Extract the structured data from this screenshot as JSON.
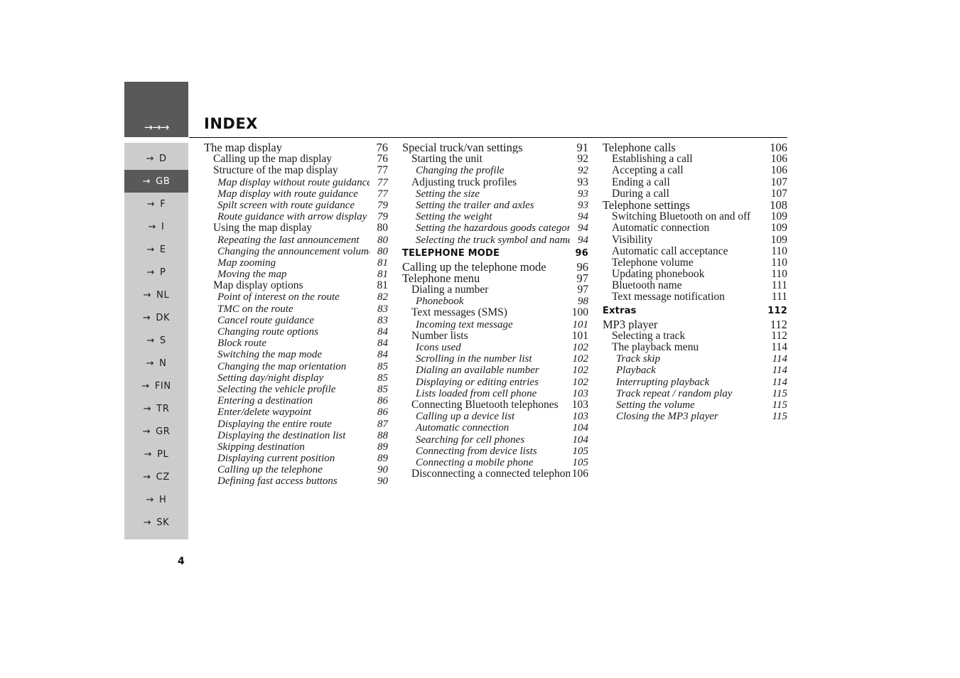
{
  "page_title": "INDEX",
  "folio": "4",
  "colors": {
    "rail_dark": "#595959",
    "rail_light": "#cccccc",
    "text": "#1a1a1a"
  },
  "nav": {
    "header_arrows": "→→→",
    "arrow_glyph": "→",
    "items": [
      {
        "label": "D",
        "active": false
      },
      {
        "label": "GB",
        "active": true
      },
      {
        "label": "F",
        "active": false
      },
      {
        "label": "I",
        "active": false
      },
      {
        "label": "E",
        "active": false
      },
      {
        "label": "P",
        "active": false
      },
      {
        "label": "NL",
        "active": false
      },
      {
        "label": "DK",
        "active": false
      },
      {
        "label": "S",
        "active": false
      },
      {
        "label": "N",
        "active": false
      },
      {
        "label": "FIN",
        "active": false
      },
      {
        "label": "TR",
        "active": false
      },
      {
        "label": "GR",
        "active": false
      },
      {
        "label": "PL",
        "active": false
      },
      {
        "label": "CZ",
        "active": false
      },
      {
        "label": "H",
        "active": false
      },
      {
        "label": "SK",
        "active": false
      }
    ]
  },
  "columns": [
    {
      "id": "column-1",
      "entries": [
        {
          "level": 1,
          "label": "The map display",
          "page": "76"
        },
        {
          "level": 2,
          "label": "Calling up the map display",
          "page": "76"
        },
        {
          "level": 2,
          "label": "Structure of the map display",
          "page": "77"
        },
        {
          "level": 3,
          "label": "Map display without route guidance",
          "page": "77"
        },
        {
          "level": 3,
          "label": "Map display with route guidance",
          "page": "77"
        },
        {
          "level": 3,
          "label": "Spilt screen with route guidance",
          "page": "79"
        },
        {
          "level": 3,
          "label": "Route guidance with arrow display",
          "page": "79"
        },
        {
          "level": 2,
          "label": "Using the map display",
          "page": "80"
        },
        {
          "level": 3,
          "label": "Repeating the last announcement",
          "page": "80"
        },
        {
          "level": 3,
          "label": "Changing the announcement volume",
          "page": "80"
        },
        {
          "level": 3,
          "label": "Map zooming",
          "page": "81"
        },
        {
          "level": 3,
          "label": "Moving the map",
          "page": "81"
        },
        {
          "level": 2,
          "label": "Map display options",
          "page": "81"
        },
        {
          "level": 3,
          "label": "Point of interest on the route",
          "page": "82"
        },
        {
          "level": 3,
          "label": "TMC on the route",
          "page": "83"
        },
        {
          "level": 3,
          "label": "Cancel route guidance",
          "page": "83"
        },
        {
          "level": 3,
          "label": "Changing route options",
          "page": "84"
        },
        {
          "level": 3,
          "label": "Block route",
          "page": "84"
        },
        {
          "level": 3,
          "label": "Switching the map mode",
          "page": "84"
        },
        {
          "level": 3,
          "label": "Changing the map orientation",
          "page": "85"
        },
        {
          "level": 3,
          "label": "Setting day/night display",
          "page": "85"
        },
        {
          "level": 3,
          "label": "Selecting the vehicle profile",
          "page": "85"
        },
        {
          "level": 3,
          "label": "Entering a destination",
          "page": "86"
        },
        {
          "level": 3,
          "label": "Enter/delete waypoint",
          "page": "86"
        },
        {
          "level": 3,
          "label": "Displaying the entire route",
          "page": "87"
        },
        {
          "level": 3,
          "label": "Displaying the destination list",
          "page": "88"
        },
        {
          "level": 3,
          "label": "Skipping destination",
          "page": "89"
        },
        {
          "level": 3,
          "label": "Displaying current position",
          "page": "89"
        },
        {
          "level": 3,
          "label": "Calling up the telephone",
          "page": "90"
        },
        {
          "level": 3,
          "label": "Defining fast access buttons",
          "page": "90"
        }
      ]
    },
    {
      "id": "column-2",
      "entries": [
        {
          "level": 1,
          "label": "Special truck/van settings",
          "page": "91"
        },
        {
          "level": 2,
          "label": "Starting the unit",
          "page": "92"
        },
        {
          "level": 3,
          "label": "Changing the profile",
          "page": "92"
        },
        {
          "level": 2,
          "label": "Adjusting truck profiles",
          "page": "93"
        },
        {
          "level": 3,
          "label": "Setting the size",
          "page": "93"
        },
        {
          "level": 3,
          "label": "Setting the trailer and axles",
          "page": "93"
        },
        {
          "level": 3,
          "label": "Setting the weight",
          "page": "94"
        },
        {
          "level": 3,
          "label": "Setting the hazardous goods category",
          "page": "94"
        },
        {
          "level": 3,
          "label": "Selecting the truck symbol and name",
          "page": "94"
        },
        {
          "level": 0,
          "label": "TELEPHONE MODE",
          "page": "96"
        },
        {
          "level": 1,
          "label": "Calling up the telephone mode",
          "page": "96"
        },
        {
          "level": 1,
          "label": "Telephone menu",
          "page": "97"
        },
        {
          "level": 2,
          "label": "Dialing a number",
          "page": "97"
        },
        {
          "level": 3,
          "label": "Phonebook",
          "page": "98"
        },
        {
          "level": 2,
          "label": "Text messages (SMS)",
          "page": "100"
        },
        {
          "level": 3,
          "label": "Incoming text message",
          "page": "101"
        },
        {
          "level": 2,
          "label": "Number lists",
          "page": "101"
        },
        {
          "level": 3,
          "label": "Icons used",
          "page": "102"
        },
        {
          "level": 3,
          "label": "Scrolling in the number list",
          "page": "102"
        },
        {
          "level": 3,
          "label": "Dialing an available number",
          "page": "102"
        },
        {
          "level": 3,
          "label": "Displaying or editing entries",
          "page": "102"
        },
        {
          "level": 3,
          "label": "Lists loaded from cell phone",
          "page": "103"
        },
        {
          "level": 2,
          "label": "Connecting Bluetooth telephones",
          "page": "103"
        },
        {
          "level": 3,
          "label": "Calling up a device list",
          "page": "103"
        },
        {
          "level": 3,
          "label": "Automatic connection",
          "page": "104"
        },
        {
          "level": 3,
          "label": "Searching for cell phones",
          "page": "104"
        },
        {
          "level": 3,
          "label": "Connecting from device lists",
          "page": "105"
        },
        {
          "level": 3,
          "label": "Connecting a mobile phone",
          "page": "105"
        },
        {
          "level": 2,
          "label": "Disconnecting a connected telephone",
          "page": "106"
        }
      ]
    },
    {
      "id": "column-3",
      "entries": [
        {
          "level": 1,
          "label": "Telephone calls",
          "page": "106"
        },
        {
          "level": 2,
          "label": "Establishing a call",
          "page": "106"
        },
        {
          "level": 2,
          "label": "Accepting a call",
          "page": "106"
        },
        {
          "level": 2,
          "label": "Ending a call",
          "page": "107"
        },
        {
          "level": 2,
          "label": "During a call",
          "page": "107"
        },
        {
          "level": 1,
          "label": "Telephone settings",
          "page": "108"
        },
        {
          "level": 2,
          "label": "Switching Bluetooth on and off",
          "page": "109"
        },
        {
          "level": 2,
          "label": "Automatic connection",
          "page": "109"
        },
        {
          "level": 2,
          "label": "Visibility",
          "page": "109"
        },
        {
          "level": 2,
          "label": "Automatic call acceptance",
          "page": "110"
        },
        {
          "level": 2,
          "label": "Telephone volume",
          "page": "110"
        },
        {
          "level": 2,
          "label": "Updating phonebook",
          "page": "110"
        },
        {
          "level": 2,
          "label": "Bluetooth name",
          "page": "111"
        },
        {
          "level": 2,
          "label": "Text message notification",
          "page": "111"
        },
        {
          "level": 0,
          "label": "Extras",
          "page": "112"
        },
        {
          "level": 1,
          "label": "MP3 player",
          "page": "112"
        },
        {
          "level": 2,
          "label": "Selecting a track",
          "page": "112"
        },
        {
          "level": 2,
          "label": "The playback menu",
          "page": "114"
        },
        {
          "level": 3,
          "label": "Track skip",
          "page": "114"
        },
        {
          "level": 3,
          "label": "Playback",
          "page": "114"
        },
        {
          "level": 3,
          "label": "Interrupting playback",
          "page": "114"
        },
        {
          "level": 3,
          "label": "Track repeat / random play",
          "page": "115"
        },
        {
          "level": 3,
          "label": "Setting the volume",
          "page": "115"
        },
        {
          "level": 3,
          "label": "Closing the MP3 player",
          "page": "115"
        }
      ]
    }
  ]
}
